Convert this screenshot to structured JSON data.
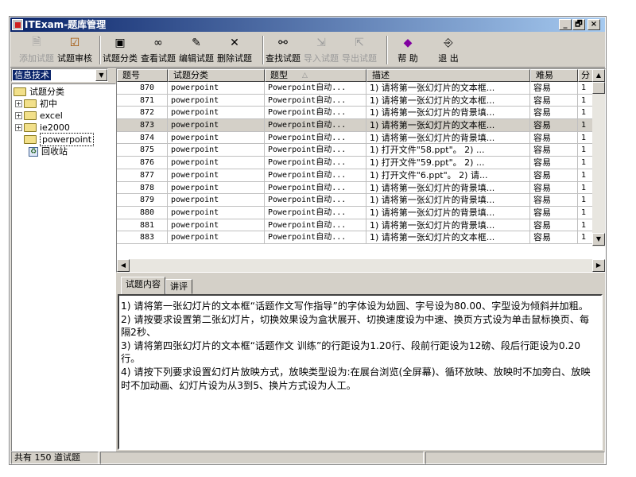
{
  "window": {
    "title": "ITExam-题库管理",
    "minimize": "_",
    "maximize": "🗗",
    "close": "×"
  },
  "toolbar": {
    "add": "添加试题",
    "review": "试题审核",
    "categorize": "试题分类",
    "view": "查看试题",
    "edit": "编辑试题",
    "delete": "删除试题",
    "find": "查找试题",
    "import": "导入试题",
    "export": "导出试题",
    "help": "帮 助",
    "exit": "退 出"
  },
  "sidebar": {
    "combo_value": "信息技术",
    "tree": [
      {
        "label": "试题分类",
        "level": 0,
        "expand": "−"
      },
      {
        "label": "初中",
        "level": 1,
        "expand": "+"
      },
      {
        "label": "excel",
        "level": 1,
        "expand": "+"
      },
      {
        "label": "ie2000",
        "level": 1,
        "expand": "+"
      },
      {
        "label": "powerpoint",
        "level": 1,
        "expand": ""
      },
      {
        "label": "回收站",
        "level": 1,
        "expand": ""
      }
    ]
  },
  "grid": {
    "columns": [
      "题号",
      "试题分类",
      "题型",
      "描述",
      "难易",
      "分"
    ],
    "sort_indicator": "△",
    "rows": [
      [
        "870",
        "powerpoint",
        "Powerpoint自动...",
        "1) 请将第一张幻灯片的文本框...",
        "容易",
        "1"
      ],
      [
        "871",
        "powerpoint",
        "Powerpoint自动...",
        "1) 请将第一张幻灯片的文本框...",
        "容易",
        "1"
      ],
      [
        "872",
        "powerpoint",
        "Powerpoint自动...",
        "1) 请将第一张幻灯片的背景填...",
        "容易",
        "1"
      ],
      [
        "873",
        "powerpoint",
        "Powerpoint自动...",
        "1) 请将第一张幻灯片的文本框...",
        "容易",
        "1"
      ],
      [
        "874",
        "powerpoint",
        "Powerpoint自动...",
        "1) 请将第一张幻灯片的背景填...",
        "容易",
        "1"
      ],
      [
        "875",
        "powerpoint",
        "Powerpoint自动...",
        "1) 打开文件\"58.ppt\"。  2) ...",
        "容易",
        "1"
      ],
      [
        "876",
        "powerpoint",
        "Powerpoint自动...",
        "1) 打开文件\"59.ppt\"。  2) ...",
        "容易",
        "1"
      ],
      [
        "877",
        "powerpoint",
        "Powerpoint自动...",
        "1) 打开文件\"6.ppt\"。  2) 请...",
        "容易",
        "1"
      ],
      [
        "878",
        "powerpoint",
        "Powerpoint自动...",
        "1) 请将第一张幻灯片的背景填...",
        "容易",
        "1"
      ],
      [
        "879",
        "powerpoint",
        "Powerpoint自动...",
        "1) 请将第一张幻灯片的背景填...",
        "容易",
        "1"
      ],
      [
        "880",
        "powerpoint",
        "Powerpoint自动...",
        "1) 请将第一张幻灯片的背景填...",
        "容易",
        "1"
      ],
      [
        "881",
        "powerpoint",
        "Powerpoint自动...",
        "1) 请将第一张幻灯片的背景填...",
        "容易",
        "1"
      ],
      [
        "883",
        "powerpoint",
        "Powerpoint自动...",
        "1) 请将第一张幻灯片的文本框...",
        "容易",
        "1"
      ]
    ],
    "selected_row": 3
  },
  "detail": {
    "tabs": [
      "试题内容",
      "讲评"
    ],
    "lines": [
      "1) 请将第一张幻灯片的文本框“话题作文写作指导”的字体设为幼圆、字号设为80.00、字型设为倾斜并加粗。",
      "2) 请按要求设置第二张幻灯片，切换效果设为盒状展开、切换速度设为中速、换页方式设为单击鼠标换页、每隔2秒、",
      "3) 请将第四张幻灯片的文本框“话题作文 训练”的行距设为1.20行、段前行距设为12磅、段后行距设为0.20行。",
      "4) 请按下列要求设置幻灯片放映方式，放映类型设为:在展台浏览(全屏幕)、循环放映、放映时不加旁白、放映时不加动画、幻灯片设为从3到5、换片方式设为人工。"
    ]
  },
  "status": {
    "count": "共有 150 道试题",
    "panel2": "",
    "panel3": ""
  },
  "colors": {
    "titlebar": "#0a246a",
    "face": "#d4d0c8",
    "selection": "#0a246a"
  }
}
